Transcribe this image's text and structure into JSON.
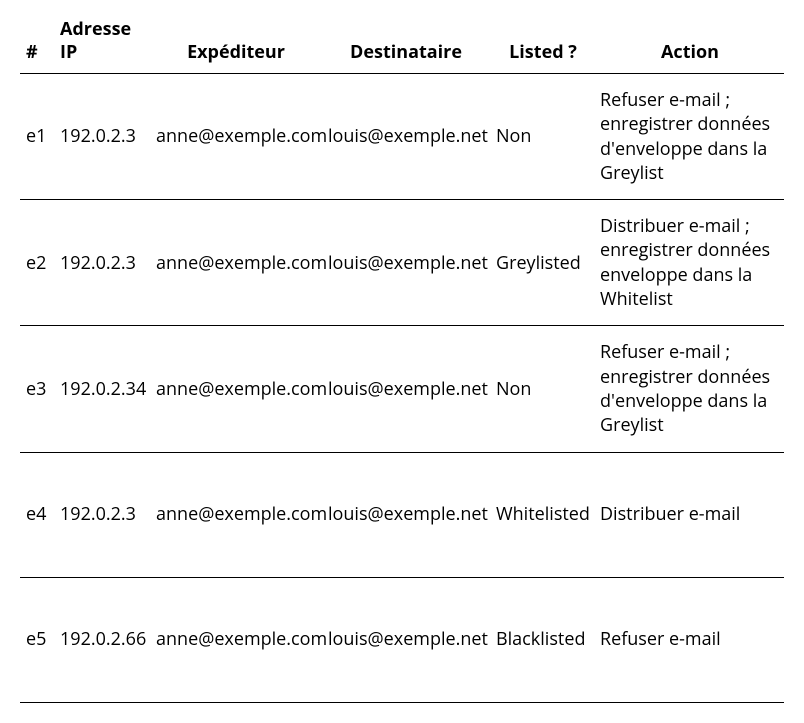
{
  "table": {
    "headers": {
      "num": "#",
      "ip": "Adresse IP",
      "from": "Expéditeur",
      "to": "Destinataire",
      "listed": "Listed ?",
      "action": "Action"
    },
    "rows": [
      {
        "num": "e1",
        "ip": "192.0.2.3",
        "from": "anne@exemple.com",
        "to": "louis@exemple.net",
        "listed": "Non",
        "action": "Refuser e-mail ; enregistrer données d'enveloppe dans la Greylist"
      },
      {
        "num": "e2",
        "ip": "192.0.2.3",
        "from": "anne@exemple.com",
        "to": "louis@exemple.net",
        "listed": "Greylisted",
        "action": "Distribuer e-mail ; enregistrer données enveloppe dans la Whitelist"
      },
      {
        "num": "e3",
        "ip": "192.0.2.34",
        "from": "anne@exemple.com",
        "to": "louis@exemple.net",
        "listed": "Non",
        "action": "Refuser e-mail ; enregistrer données d'enveloppe dans la Greylist"
      },
      {
        "num": "e4",
        "ip": "192.0.2.3",
        "from": "anne@exemple.com",
        "to": "louis@exemple.net",
        "listed": "Whitelisted",
        "action": "Distribuer e-mail"
      },
      {
        "num": "e5",
        "ip": "192.0.2.66",
        "from": "anne@exemple.com",
        "to": "louis@exemple.net",
        "listed": "Blacklisted",
        "action": "Refuser e-mail"
      }
    ]
  }
}
